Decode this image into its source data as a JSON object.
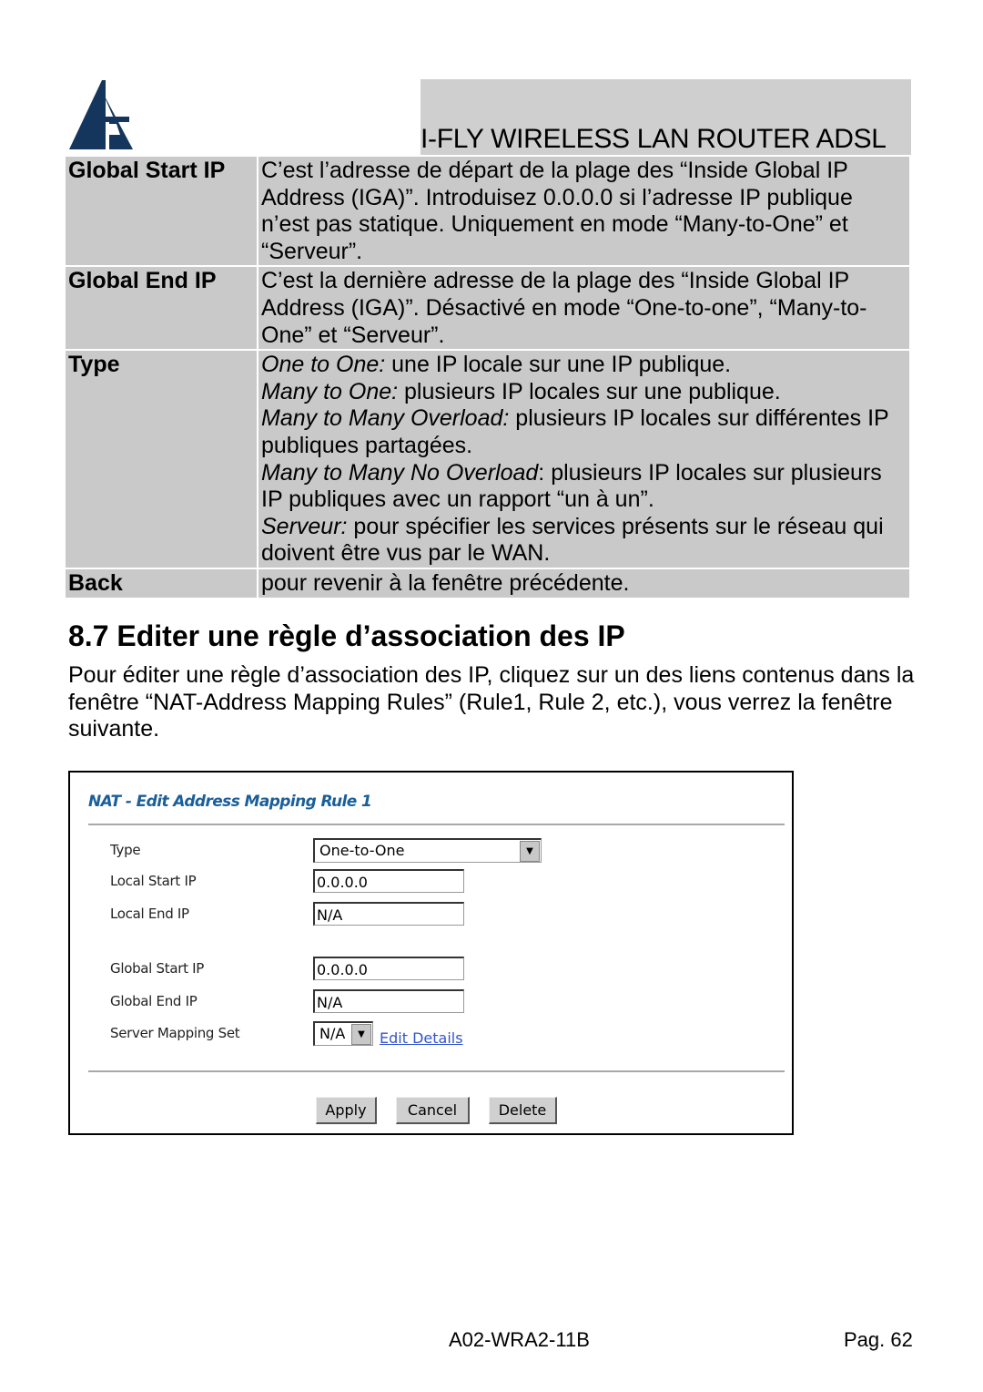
{
  "header": {
    "title": "I-FLY WIRELESS LAN ROUTER ADSL",
    "logo_text": "A"
  },
  "table": [
    {
      "key": "Global Start IP",
      "value": "C’est l’adresse de départ de la plage des “Inside Global IP Address (IGA)”. Introduisez 0.0.0.0 si l’adresse IP publique n’est pas statique. Uniquement en mode “Many-to-One” et “Serveur”."
    },
    {
      "key": "Global End IP",
      "value": "C’est la dernière adresse de la plage des “Inside Global IP Address (IGA)”. Désactivé en mode “One-to-one”, “Many-to-One” et “Serveur”."
    },
    {
      "key": "Type",
      "items": [
        {
          "term": "One to One:",
          "text": " une IP locale sur une IP publique."
        },
        {
          "term": "Many to One:",
          "text": " plusieurs IP locales sur une publique."
        },
        {
          "term": "Many to Many Overload:",
          "text": " plusieurs IP locales sur différentes IP publiques partagées."
        },
        {
          "term": "Many to Many No Overload",
          "text": ": plusieurs IP locales sur plusieurs IP publiques avec un rapport “un à un”."
        },
        {
          "term": "Serveur:",
          "text": " pour spécifier les services présents sur le réseau qui doivent être vus par le WAN."
        }
      ]
    },
    {
      "key": "Back",
      "value": "pour revenir à la fenêtre précédente."
    }
  ],
  "section": {
    "title": "8.7 Editer une règle d’association des IP",
    "intro": "Pour éditer une règle d’association des IP, cliquez sur un des liens contenus dans la fenêtre “NAT-Address Mapping Rules” (Rule1, Rule 2, etc.), vous verrez la fenêtre suivante."
  },
  "screenshot": {
    "title": "NAT - Edit Address Mapping Rule 1",
    "type_label": "Type",
    "type_value": "One-to-One",
    "local_start_label": "Local Start IP",
    "local_start_value": "0.0.0.0",
    "local_end_label": "Local End IP",
    "local_end_value": "N/A",
    "global_start_label": "Global Start IP",
    "global_start_value": "0.0.0.0",
    "global_end_label": "Global End IP",
    "global_end_value": "N/A",
    "server_set_label": "Server Mapping Set",
    "server_set_value": "N/A",
    "edit_details": "Edit Details",
    "apply": "Apply",
    "cancel": "Cancel",
    "delete": "Delete"
  },
  "footer": {
    "code": "A02-WRA2-11B",
    "page": "Pag. 62"
  },
  "colors": {
    "table_bg": "#c9c9c9",
    "logo": "#14365c",
    "nat_title": "#1a5f9a",
    "link": "#3355cc"
  }
}
